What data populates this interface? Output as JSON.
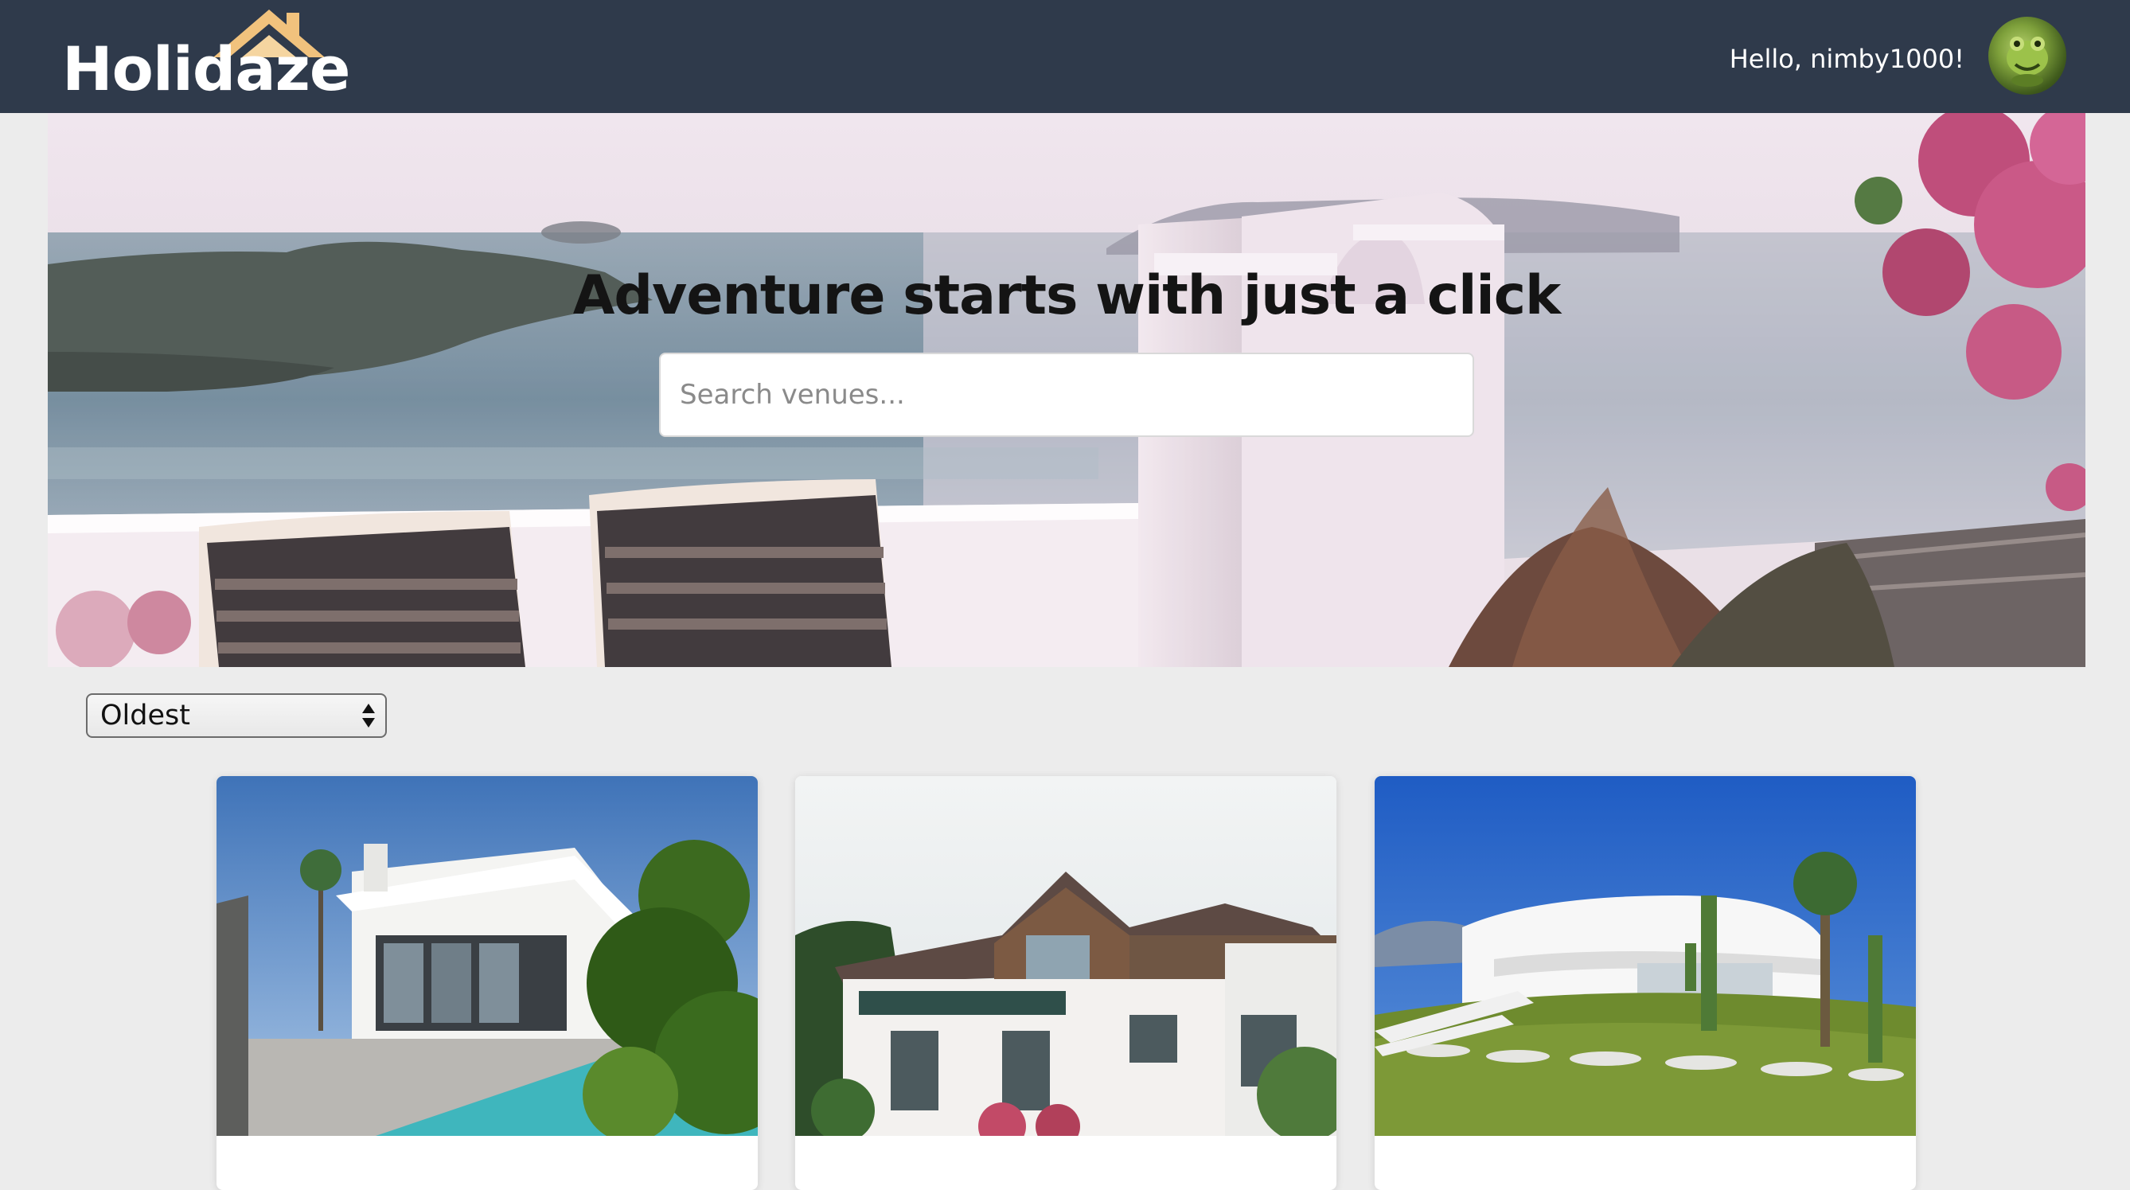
{
  "header": {
    "logo_text": "Holidaze",
    "greeting": "Hello, nimby1000!",
    "avatar_icon": "frog-avatar-icon",
    "logo_icon": "house-roof-icon"
  },
  "hero": {
    "title": "Adventure starts with just a click",
    "search": {
      "placeholder": "Search venues...",
      "value": ""
    }
  },
  "sort": {
    "selected": "Oldest",
    "icon": "select-arrows-icon"
  },
  "venues": [
    {
      "image": "modern-villa-with-pool"
    },
    {
      "image": "white-house-with-tiled-roof"
    },
    {
      "image": "white-curved-villa-with-lawn"
    }
  ],
  "colors": {
    "header_bg": "#2f3a4b",
    "logo_accent": "#f1c27d",
    "page_bg": "#ececec"
  }
}
